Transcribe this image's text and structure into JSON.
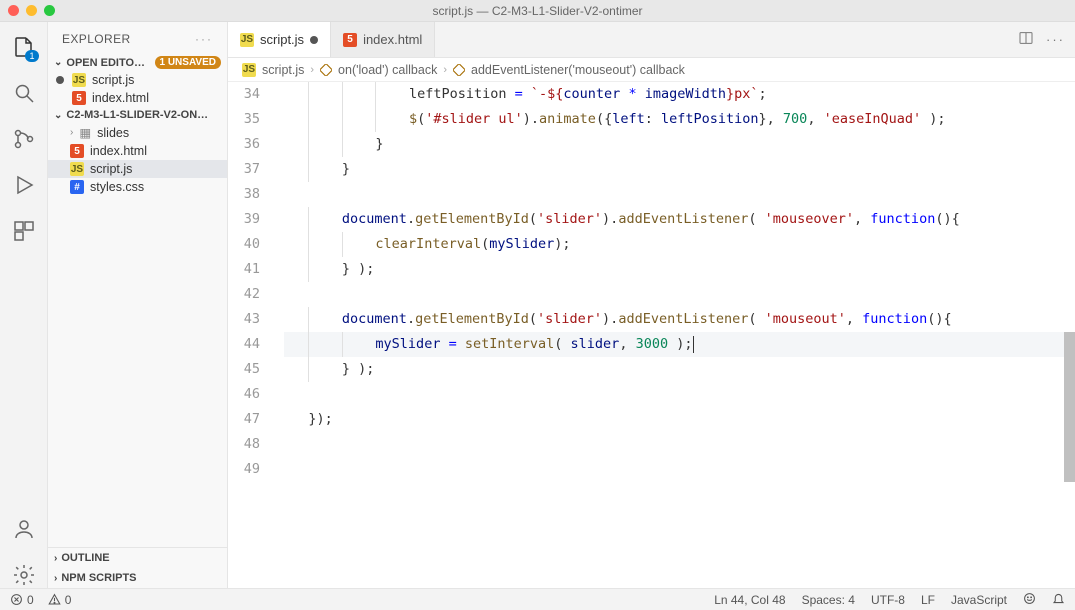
{
  "window": {
    "title": "script.js — C2-M3-L1-Slider-V2-ontimer"
  },
  "sidebar": {
    "title": "EXPLORER",
    "sections": {
      "openEditors": {
        "label": "OPEN EDITO…",
        "badge": "1 UNSAVED",
        "items": [
          {
            "name": "script.js",
            "type": "js",
            "unsaved": true
          },
          {
            "name": "index.html",
            "type": "html",
            "unsaved": false
          }
        ]
      },
      "project": {
        "label": "C2-M3-L1-SLIDER-V2-ON…",
        "items": [
          {
            "name": "slides",
            "type": "folder"
          },
          {
            "name": "index.html",
            "type": "html"
          },
          {
            "name": "script.js",
            "type": "js",
            "selected": true
          },
          {
            "name": "styles.css",
            "type": "css"
          }
        ]
      },
      "outline": {
        "label": "OUTLINE"
      },
      "npm": {
        "label": "NPM SCRIPTS"
      }
    }
  },
  "activityBadge": "1",
  "tabs": [
    {
      "name": "script.js",
      "type": "js",
      "active": true,
      "dirty": true
    },
    {
      "name": "index.html",
      "type": "html",
      "active": false,
      "dirty": false
    }
  ],
  "breadcrumb": {
    "file": "script.js",
    "fn1": "on('load') callback",
    "fn2": "addEventListener('mouseout') callback"
  },
  "code": {
    "startLine": 34,
    "currentLine": 44,
    "lines": [
      {
        "n": 34,
        "indent": 3,
        "html": "leftPosition <span class='c-kw'>=</span> <span class='c-tmpl'>`-${</span><span class='c-prop'>counter</span> <span class='c-kw'>*</span> <span class='c-prop'>imageWidth</span><span class='c-tmpl'>}px`</span>;"
      },
      {
        "n": 35,
        "indent": 3,
        "html": "<span class='c-fn'>$</span>(<span class='c-str'>'#slider ul'</span>).<span class='c-fn'>animate</span>({<span class='c-prop'>left</span>: <span class='c-prop'>leftPosition</span>}, <span class='c-num'>700</span>, <span class='c-str'>'easeInQuad'</span> );"
      },
      {
        "n": 36,
        "indent": 2,
        "html": "}"
      },
      {
        "n": 37,
        "indent": 1,
        "html": "}"
      },
      {
        "n": 38,
        "indent": 0,
        "html": ""
      },
      {
        "n": 39,
        "indent": 1,
        "html": "<span class='c-prop'>document</span>.<span class='c-fn'>getElementById</span>(<span class='c-str'>'slider'</span>).<span class='c-fn'>addEventListener</span>( <span class='c-str'>'mouseover'</span>, <span class='c-kw'>function</span>(){"
      },
      {
        "n": 40,
        "indent": 2,
        "html": "<span class='c-fn'>clearInterval</span>(<span class='c-prop'>mySlider</span>);"
      },
      {
        "n": 41,
        "indent": 1,
        "html": "} );"
      },
      {
        "n": 42,
        "indent": 0,
        "html": ""
      },
      {
        "n": 43,
        "indent": 1,
        "html": "<span class='c-prop'>document</span>.<span class='c-fn'>getElementById</span>(<span class='c-str'>'slider'</span>).<span class='c-fn'>addEventListener</span>( <span class='c-str'>'mouseout'</span>, <span class='c-kw'>function</span>(){"
      },
      {
        "n": 44,
        "indent": 2,
        "html": "<span class='c-prop'>mySlider</span> <span class='c-kw'>=</span> <span class='c-fn'>setInterval</span>( <span class='c-prop'>slider</span>, <span class='c-num'>3000</span> );<span class='cursor-bar'></span>",
        "current": true
      },
      {
        "n": 45,
        "indent": 1,
        "html": "} );"
      },
      {
        "n": 46,
        "indent": 0,
        "html": ""
      },
      {
        "n": 47,
        "indent": 0,
        "html": "});"
      },
      {
        "n": 48,
        "indent": 0,
        "html": ""
      },
      {
        "n": 49,
        "indent": 0,
        "html": ""
      }
    ]
  },
  "status": {
    "errors": "0",
    "warnings": "0",
    "lncol": "Ln 44, Col 48",
    "spaces": "Spaces: 4",
    "encoding": "UTF-8",
    "eol": "LF",
    "lang": "JavaScript"
  }
}
